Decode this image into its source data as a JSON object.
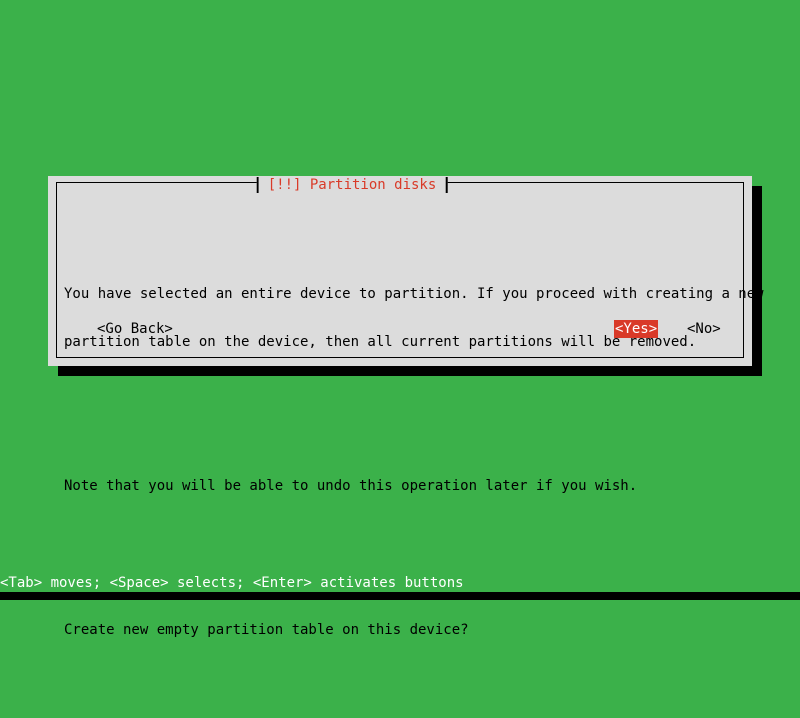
{
  "screen": {
    "background_color": "#3bb14a",
    "bottom_strip_color": "#000000"
  },
  "dialog": {
    "title": "[!!] Partition disks",
    "title_color": "#d93a28",
    "background_color": "#dcdcdc",
    "border_color": "#000000",
    "shadow_color": "#000000",
    "paragraphs": [
      {
        "lines": [
          "You have selected an entire device to partition. If you proceed with creating a new",
          "partition table on the device, then all current partitions will be removed."
        ]
      },
      {
        "lines": [
          "Note that you will be able to undo this operation later if you wish."
        ]
      },
      {
        "lines": [
          "Create new empty partition table on this device?"
        ]
      }
    ],
    "buttons": {
      "go_back": "<Go Back>",
      "yes": "<Yes>",
      "no": "<No>",
      "selected": "<Yes>",
      "selected_background": "#d93a28",
      "selected_foreground": "#ffffff"
    }
  },
  "status_bar": {
    "text": "<Tab> moves; <Space> selects; <Enter> activates buttons",
    "color": "#ffffff"
  }
}
